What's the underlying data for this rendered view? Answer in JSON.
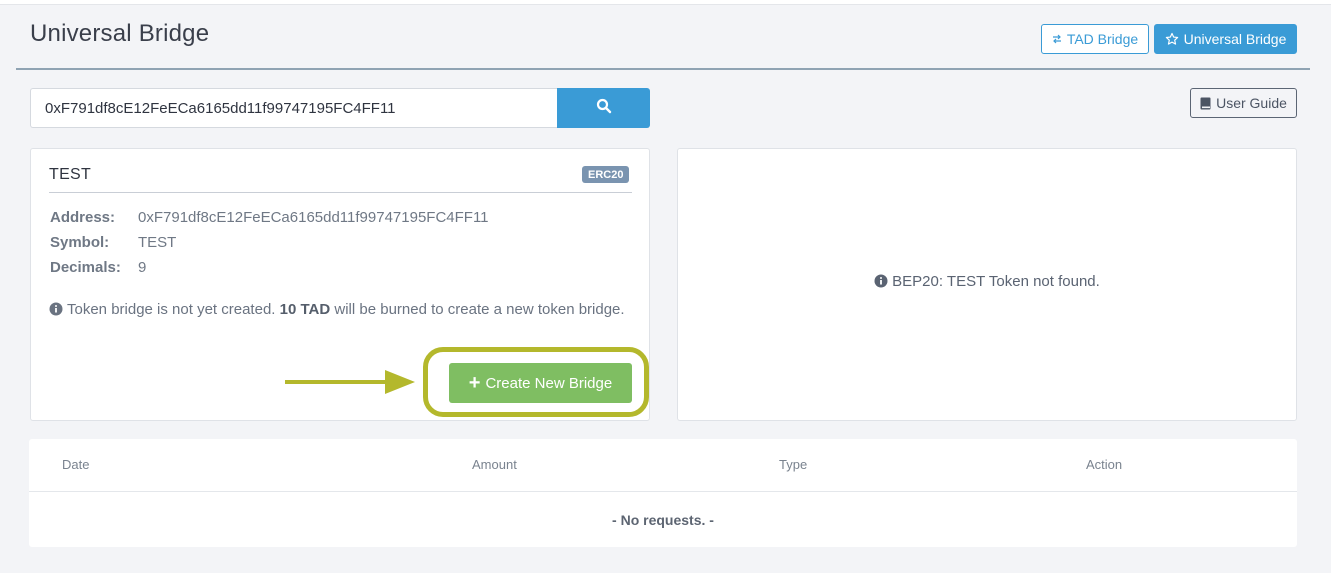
{
  "header": {
    "title": "Universal Bridge",
    "tad_bridge_label": "TAD Bridge",
    "universal_bridge_label": "Universal Bridge",
    "user_guide_label": "User Guide"
  },
  "search": {
    "value": "0xF791df8cE12FeECa6165dd11f99747195FC4FF11"
  },
  "token_card": {
    "name": "TEST",
    "standard_badge": "ERC20",
    "details": [
      {
        "label": "Address:",
        "value": "0xF791df8cE12FeECa6165dd11f99747195FC4FF11"
      },
      {
        "label": "Symbol:",
        "value": "TEST"
      },
      {
        "label": "Decimals:",
        "value": "9"
      }
    ],
    "notice_before": "Token bridge is not yet created.",
    "notice_bold": "10 TAD",
    "notice_after": "will be burned to create a new token bridge.",
    "create_button_label": "Create New Bridge"
  },
  "bep_card": {
    "message": "BEP20: TEST Token not found."
  },
  "requests_table": {
    "columns": [
      "Date",
      "Amount",
      "Type",
      "Action"
    ],
    "empty_message": "- No requests. -"
  },
  "colors": {
    "primary": "#3a9bd6",
    "success": "#7fbe62",
    "highlight": "#b4b82c",
    "badge": "#7a94b0"
  },
  "icons": {
    "tad_bridge": "exchange-icon",
    "universal_bridge": "star-icon",
    "search": "search-icon",
    "user_guide": "book-icon",
    "info": "info-circle-icon",
    "create": "plus-icon"
  }
}
